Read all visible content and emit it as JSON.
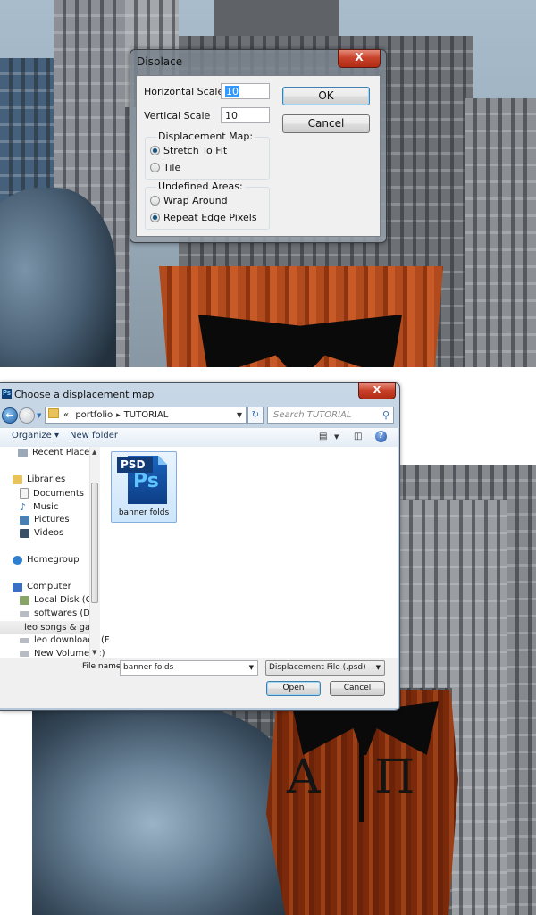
{
  "displace_dialog": {
    "title": "Displace",
    "close_label": "X",
    "horizontal_scale_label": "Horizontal Scale",
    "horizontal_scale_value": "10",
    "vertical_scale_label": "Vertical Scale",
    "vertical_scale_value": "10",
    "ok_label": "OK",
    "cancel_label": "Cancel",
    "displacement_map": {
      "label": "Displacement Map:",
      "options": [
        {
          "label": "Stretch To Fit",
          "selected": true
        },
        {
          "label": "Tile",
          "selected": false
        }
      ]
    },
    "undefined_areas": {
      "label": "Undefined Areas:",
      "options": [
        {
          "label": "Wrap Around",
          "selected": false
        },
        {
          "label": "Repeat Edge Pixels",
          "selected": true
        }
      ]
    }
  },
  "file_dialog": {
    "app_icon": "Ps",
    "title": "Choose a displacement map",
    "close_label": "X",
    "breadcrumb": {
      "prefix": "«",
      "items": [
        "portfolio",
        "TUTORIAL"
      ]
    },
    "search_placeholder": "Search TUTORIAL",
    "toolbar": {
      "organize_label": "Organize ▾",
      "new_folder_label": "New folder"
    },
    "nav_items": [
      {
        "label": "Recent Places",
        "icon": "recent-places-icon"
      },
      {
        "label": "Libraries",
        "icon": "libraries-icon"
      },
      {
        "label": "Documents",
        "icon": "documents-icon"
      },
      {
        "label": "Music",
        "icon": "music-icon"
      },
      {
        "label": "Pictures",
        "icon": "pictures-icon"
      },
      {
        "label": "Videos",
        "icon": "videos-icon"
      },
      {
        "label": "Homegroup",
        "icon": "homegroup-icon"
      },
      {
        "label": "Computer",
        "icon": "computer-icon"
      },
      {
        "label": "Local Disk (C:)",
        "icon": "drive-icon"
      },
      {
        "label": "softwares (D:)",
        "icon": "drive-icon"
      },
      {
        "label": "leo songs & gam",
        "icon": "drive-icon"
      },
      {
        "label": "leo downloads (F",
        "icon": "drive-icon"
      },
      {
        "label": "New Volume (J:)",
        "icon": "drive-icon"
      }
    ],
    "files": [
      {
        "name": "banner folds",
        "type_badge": "PSD",
        "icon_text": "Ps"
      }
    ],
    "file_name_label": "File name:",
    "file_name_value": "banner folds",
    "file_type_value": "Displacement File (.psd)",
    "open_label": "Open",
    "cancel_label": "Cancel"
  },
  "artwork": {
    "banner_letters": [
      "Α",
      "Π"
    ]
  }
}
